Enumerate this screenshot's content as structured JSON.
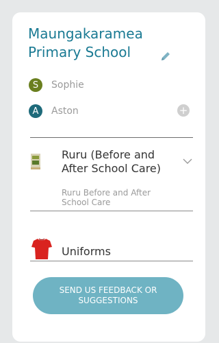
{
  "school": {
    "name": "Maungakaramea Primary School"
  },
  "children": [
    {
      "initial": "S",
      "name": "Sophie",
      "color": "#6a7f1f"
    },
    {
      "initial": "A",
      "name": "Aston",
      "color": "#1e6a7a"
    }
  ],
  "add_child": {
    "symbol": "+"
  },
  "services": [
    {
      "title": "Ruru (Before and After School Care)",
      "subtitle": "Ruru Before and After School Care"
    }
  ],
  "uniforms": {
    "label": "Uniforms"
  },
  "feedback": {
    "label": "SEND US FEEDBACK OR SUGGESTIONS"
  },
  "colors": {
    "accent": "#1a7a93",
    "button": "#6fb3c3",
    "uniform_red": "#d9231f"
  }
}
